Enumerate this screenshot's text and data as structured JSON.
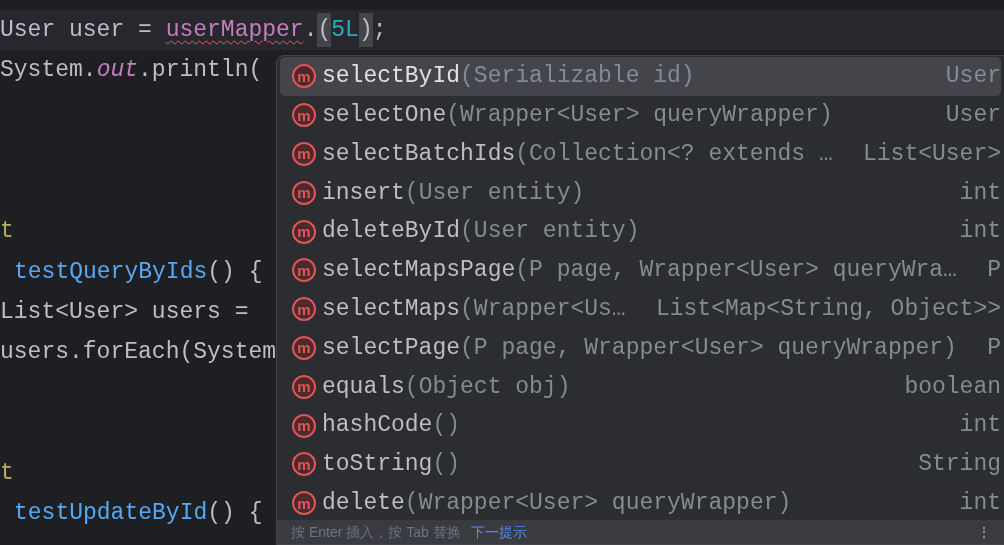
{
  "editor": {
    "lines": [
      {
        "kind": "code",
        "current": true,
        "tokens": [
          {
            "kind": "plain",
            "text": "User user = "
          },
          {
            "kind": "error-field",
            "text": "userMapper"
          },
          {
            "kind": "plain",
            "text": "."
          },
          {
            "kind": "paren-match",
            "text": "("
          },
          {
            "kind": "number",
            "text": "5L"
          },
          {
            "kind": "paren-match",
            "text": ")"
          },
          {
            "kind": "plain",
            "text": ";"
          }
        ]
      },
      {
        "kind": "code",
        "current": false,
        "tokens": [
          {
            "kind": "plain",
            "text": "System."
          },
          {
            "kind": "static-field",
            "text": "out"
          },
          {
            "kind": "plain",
            "text": ".println("
          }
        ]
      },
      {
        "kind": "blank"
      },
      {
        "kind": "blank"
      },
      {
        "kind": "blank"
      },
      {
        "kind": "code",
        "current": false,
        "tokens": [
          {
            "kind": "annotation",
            "text": "t"
          }
        ]
      },
      {
        "kind": "indented",
        "current": false,
        "tokens": [
          {
            "kind": "method",
            "text": "testQueryByIds"
          },
          {
            "kind": "plain",
            "text": "() {"
          }
        ]
      },
      {
        "kind": "code",
        "current": false,
        "tokens": [
          {
            "kind": "plain",
            "text": "List<User> users = "
          }
        ]
      },
      {
        "kind": "code",
        "current": false,
        "tokens": [
          {
            "kind": "plain",
            "text": "users.forEach(System"
          }
        ]
      },
      {
        "kind": "blank"
      },
      {
        "kind": "blank"
      },
      {
        "kind": "code",
        "current": false,
        "tokens": [
          {
            "kind": "annotation",
            "text": "t"
          }
        ]
      },
      {
        "kind": "indented",
        "current": false,
        "tokens": [
          {
            "kind": "method",
            "text": "testUpdateById"
          },
          {
            "kind": "plain",
            "text": "() {"
          }
        ]
      }
    ]
  },
  "completion": {
    "items": [
      {
        "icon": "m",
        "name": "selectById",
        "params": "(Serializable id)",
        "type": "User",
        "selected": true
      },
      {
        "icon": "m",
        "name": "selectOne",
        "params": "(Wrapper<User> queryWrapper)",
        "type": "User",
        "selected": false
      },
      {
        "icon": "m",
        "name": "selectBatchIds",
        "params": "(Collection<? extends …",
        "type": "List<User>",
        "selected": false
      },
      {
        "icon": "m",
        "name": "insert",
        "params": "(User entity)",
        "type": "int",
        "selected": false
      },
      {
        "icon": "m",
        "name": "deleteById",
        "params": "(User entity)",
        "type": "int",
        "selected": false
      },
      {
        "icon": "m",
        "name": "selectMapsPage",
        "params": "(P page, Wrapper<User> queryWra…",
        "type": "P",
        "selected": false
      },
      {
        "icon": "m",
        "name": "selectMaps",
        "params": "(Wrapper<Us…",
        "type": "List<Map<String, Object>>",
        "selected": false
      },
      {
        "icon": "m",
        "name": "selectPage",
        "params": "(P page, Wrapper<User> queryWrapper)",
        "type": "P",
        "selected": false
      },
      {
        "icon": "m",
        "name": "equals",
        "params": "(Object obj)",
        "type": "boolean",
        "selected": false
      },
      {
        "icon": "m",
        "name": "hashCode",
        "params": "()",
        "type": "int",
        "selected": false
      },
      {
        "icon": "m",
        "name": "toString",
        "params": "()",
        "type": "String",
        "selected": false
      },
      {
        "icon": "m",
        "name": "delete",
        "params": "(Wrapper<User> queryWrapper)",
        "type": "int",
        "selected": false
      }
    ],
    "footer": {
      "hint": "按 Enter 插入，按 Tab 替换",
      "link": "下一提示",
      "menu": "⋮"
    }
  }
}
